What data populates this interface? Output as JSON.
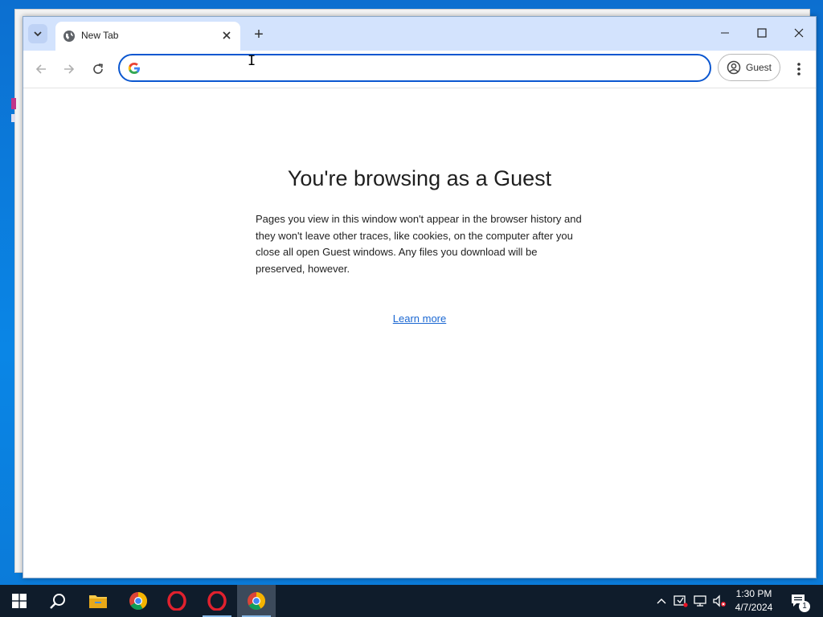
{
  "browser": {
    "tab": {
      "title": "New Tab"
    },
    "new_tab_symbol": "+",
    "omnibox": {
      "value": "",
      "placeholder": ""
    },
    "profile": {
      "label": "Guest"
    }
  },
  "page": {
    "title": "You're browsing as a Guest",
    "description": "Pages you view in this window won't appear in the browser history and they won't leave other traces, like cookies, on the computer after you close all open Guest windows. Any files you download will be preserved, however.",
    "link": "Learn more"
  },
  "taskbar": {
    "apps": [
      "start-icon",
      "search-icon",
      "file-explorer-icon",
      "chrome-icon",
      "opera-icon",
      "opera-icon",
      "chrome-icon"
    ],
    "clock": {
      "time": "1:30 PM",
      "date": "4/7/2024"
    },
    "notification_count": "1"
  },
  "colors": {
    "accent": "#0b57d0",
    "tabstrip": "#d3e3fd",
    "link": "#1a67d2",
    "taskbar": "#0f1c2b"
  }
}
